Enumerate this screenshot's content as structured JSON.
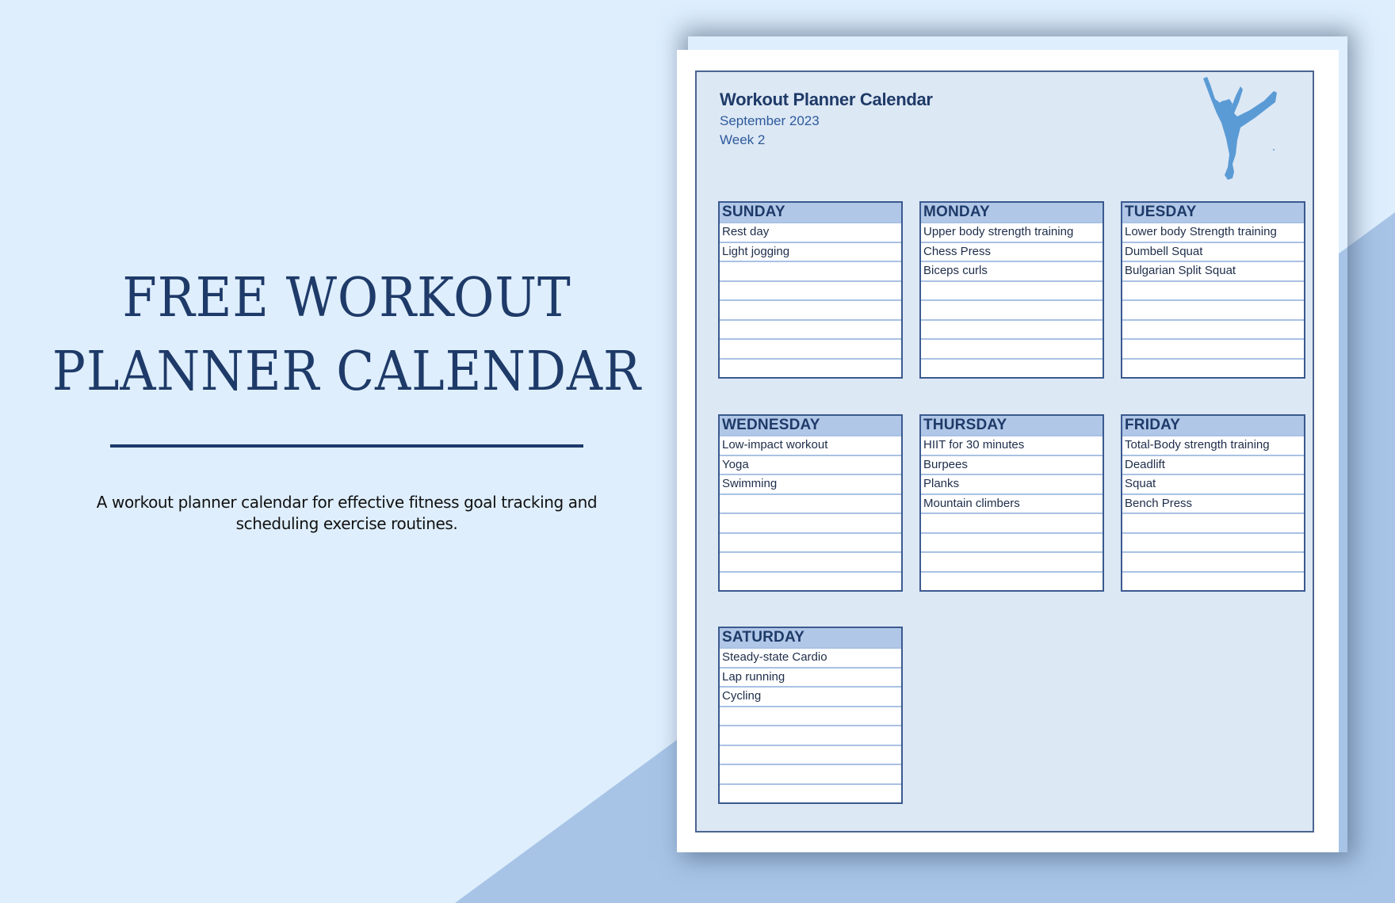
{
  "hero": {
    "title_line1": "FREE WORKOUT",
    "title_line2": "PLANNER CALENDAR",
    "description": "A workout planner calendar for effective fitness goal tracking and scheduling exercise routines."
  },
  "document": {
    "title": "Workout Planner Calendar",
    "month": "September 2023",
    "week": "Week 2",
    "illustration": "dancer-silhouette-icon",
    "days": [
      {
        "name": "SUNDAY",
        "items": [
          "Rest day",
          "Light jogging",
          "",
          "",
          "",
          "",
          "",
          ""
        ]
      },
      {
        "name": "MONDAY",
        "items": [
          "Upper body strength training",
          "Chess Press",
          "Biceps curls",
          "",
          "",
          "",
          "",
          ""
        ]
      },
      {
        "name": "TUESDAY",
        "items": [
          "Lower body Strength training",
          "Dumbell Squat",
          "Bulgarian Split Squat",
          "",
          "",
          "",
          "",
          ""
        ]
      },
      {
        "name": "WEDNESDAY",
        "items": [
          "Low-impact workout",
          "Yoga",
          "Swimming",
          "",
          "",
          "",
          "",
          ""
        ]
      },
      {
        "name": "THURSDAY",
        "items": [
          "HIIT for 30 minutes",
          "Burpees",
          "Planks",
          "Mountain climbers",
          "",
          "",
          "",
          ""
        ]
      },
      {
        "name": "FRIDAY",
        "items": [
          "Total-Body strength training",
          "Deadlift",
          "Squat",
          "Bench Press",
          "",
          "",
          "",
          ""
        ]
      },
      {
        "name": "SATURDAY",
        "items": [
          "Steady-state Cardio",
          "Lap running",
          "Cycling",
          "",
          "",
          "",
          "",
          ""
        ]
      }
    ]
  },
  "colors": {
    "background_light": "#deeefd",
    "background_accent": "#a7c4e6",
    "title_navy": "#1e3a68",
    "header_fill": "#b1c7e7",
    "sheet_fill": "#dde8f5",
    "figure_blue": "#5b9bd5"
  }
}
